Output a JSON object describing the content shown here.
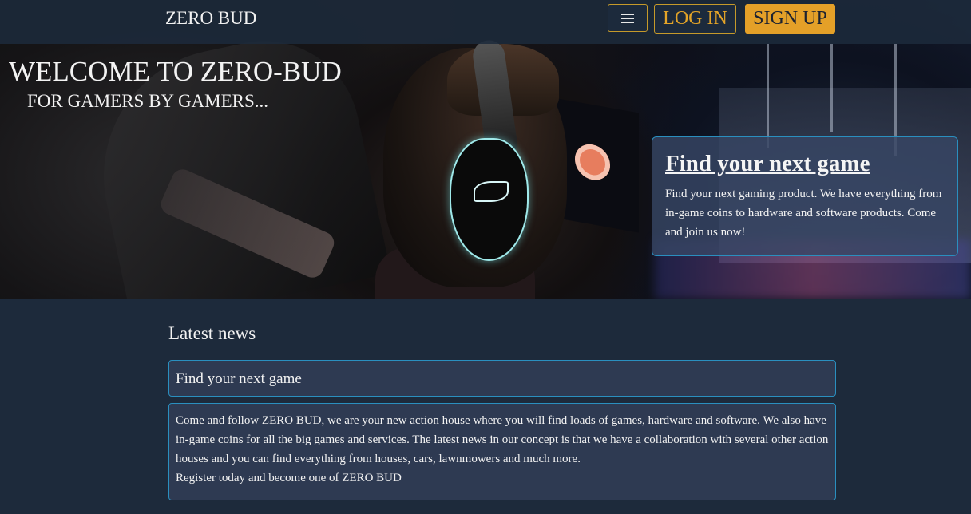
{
  "navbar": {
    "brand": "ZERO BUD",
    "menu_icon": "hamburger-menu-icon",
    "login_label": "LOG IN",
    "signup_label": "SIGN UP"
  },
  "hero": {
    "title": "WELCOME TO ZERO-BUD",
    "subtitle": "FOR GAMERS BY GAMERS...",
    "promo": {
      "title": "Find your next game",
      "text": "Find your next gaming product. We have everything from in-game coins to hardware and software products. Come and join us now!"
    }
  },
  "news": {
    "heading": "Latest news",
    "card_title": "Find your next game",
    "card_body": "Come and follow ZERO BUD, we are your new action house where you will find loads of games, hardware and software. We also have in-game coins for all the big games and services. The latest news in our concept is that we have a collaboration with several other action houses and you can find everything from houses, cars, lawnmowers and much more.",
    "card_footer": "Register today and become one of ZERO BUD"
  },
  "colors": {
    "background": "#1d2a3b",
    "accent": "#e4a028",
    "card": "#2e3a52",
    "card_border": "#2a8fbf"
  }
}
